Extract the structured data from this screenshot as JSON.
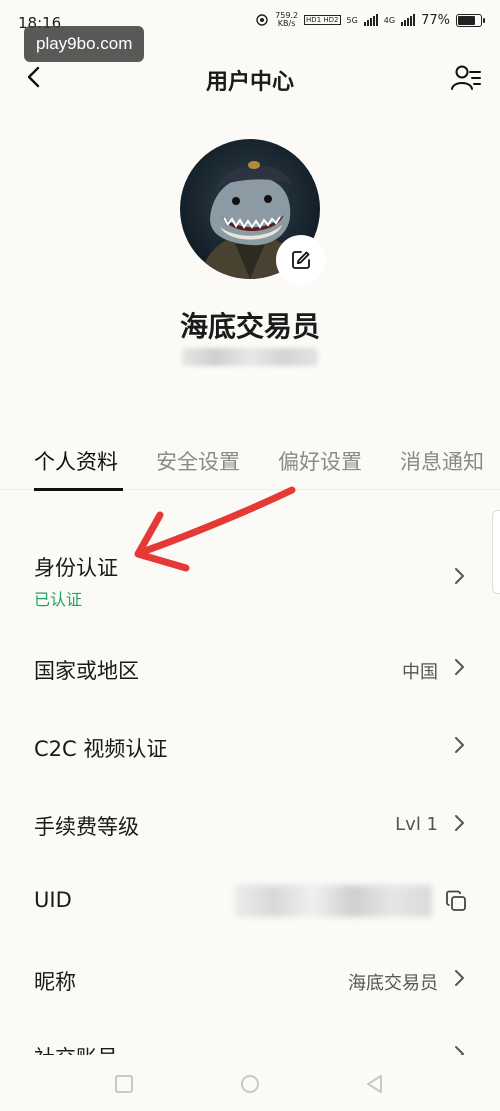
{
  "status_bar": {
    "time": "18:16",
    "net_speed_value": "759.2",
    "net_speed_unit": "KB/s",
    "hd_badge": "HD1 HD2",
    "sim1_label": "5G",
    "sim2_label": "4G",
    "battery_text": "77%",
    "battery_level": 0.77
  },
  "watermark": "play9bo.com",
  "header": {
    "title": "用户中心",
    "back_icon": "chevron-left-icon",
    "right_icon": "user-switch-icon"
  },
  "profile": {
    "nickname": "海底交易员",
    "edit_icon": "edit-icon"
  },
  "tabs": [
    {
      "label": "个人资料",
      "active": true
    },
    {
      "label": "安全设置",
      "active": false
    },
    {
      "label": "偏好设置",
      "active": false
    },
    {
      "label": "消息通知",
      "active": false
    }
  ],
  "rows": {
    "identity": {
      "label": "身份认证",
      "sub": "已认证"
    },
    "country": {
      "label": "国家或地区",
      "value": "中国"
    },
    "c2c": {
      "label": "C2C 视频认证"
    },
    "fee": {
      "label": "手续费等级",
      "value": "Lvl 1"
    },
    "uid": {
      "label": "UID"
    },
    "nickname": {
      "label": "昵称",
      "value": "海底交易员"
    },
    "social": {
      "label": "社交账号"
    }
  },
  "colors": {
    "verified_green": "#22a45d",
    "annotation_red": "#e53935",
    "background": "#fbfaf6"
  },
  "nav_bar": {
    "icons": [
      "recent-apps-icon",
      "home-icon",
      "back-triangle-icon"
    ]
  }
}
